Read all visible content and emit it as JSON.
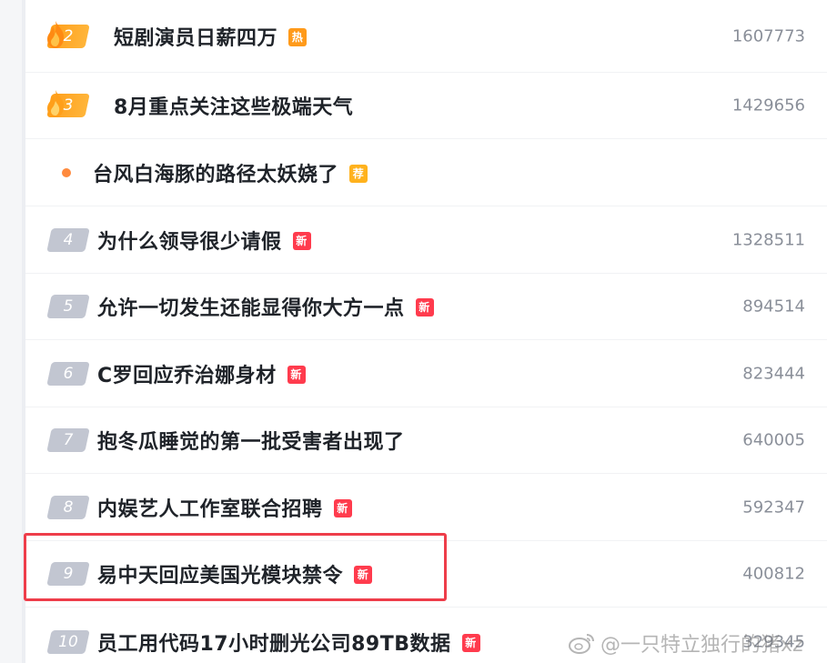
{
  "rows": [
    {
      "rank": "2",
      "title": "短剧演员日薪四万",
      "tag": "热",
      "tag_type": "hot",
      "count": "1607773",
      "top": 0,
      "hot": true
    },
    {
      "rank": "3",
      "title": "8月重点关注这些极端天气",
      "tag": "",
      "tag_type": "",
      "count": "1429656",
      "hot": true
    },
    {
      "rank": "",
      "title": "台风白海豚的路径太妖娆了",
      "tag": "荐",
      "tag_type": "rec",
      "count": "",
      "promoted": true
    },
    {
      "rank": "4",
      "title": "为什么领导很少请假",
      "tag": "新",
      "tag_type": "new",
      "count": "1328511"
    },
    {
      "rank": "5",
      "title": "允许一切发生还能显得你大方一点",
      "tag": "新",
      "tag_type": "new",
      "count": "894514"
    },
    {
      "rank": "6",
      "title": "C罗回应乔治娜身材",
      "tag": "新",
      "tag_type": "new",
      "count": "823444"
    },
    {
      "rank": "7",
      "title": "抱冬瓜睡觉的第一批受害者出现了",
      "tag": "",
      "tag_type": "",
      "count": "640005"
    },
    {
      "rank": "8",
      "title": "内娱艺人工作室联合招聘",
      "tag": "新",
      "tag_type": "new",
      "count": "592347"
    },
    {
      "rank": "9",
      "title": "易中天回应美国光模块禁令",
      "tag": "新",
      "tag_type": "new",
      "count": "400812"
    },
    {
      "rank": "10",
      "title": "员工用代码17小时删光公司89TB数据",
      "tag": "新",
      "tag_type": "new",
      "count": "329345"
    }
  ],
  "watermark": "@一只特立独行的猪xz",
  "colors": {
    "hot_tag": "#ff9a1a",
    "new_tag": "#ff3b4d",
    "rec_tag": "#ffb21d",
    "highlight": "#ee3d4a"
  }
}
